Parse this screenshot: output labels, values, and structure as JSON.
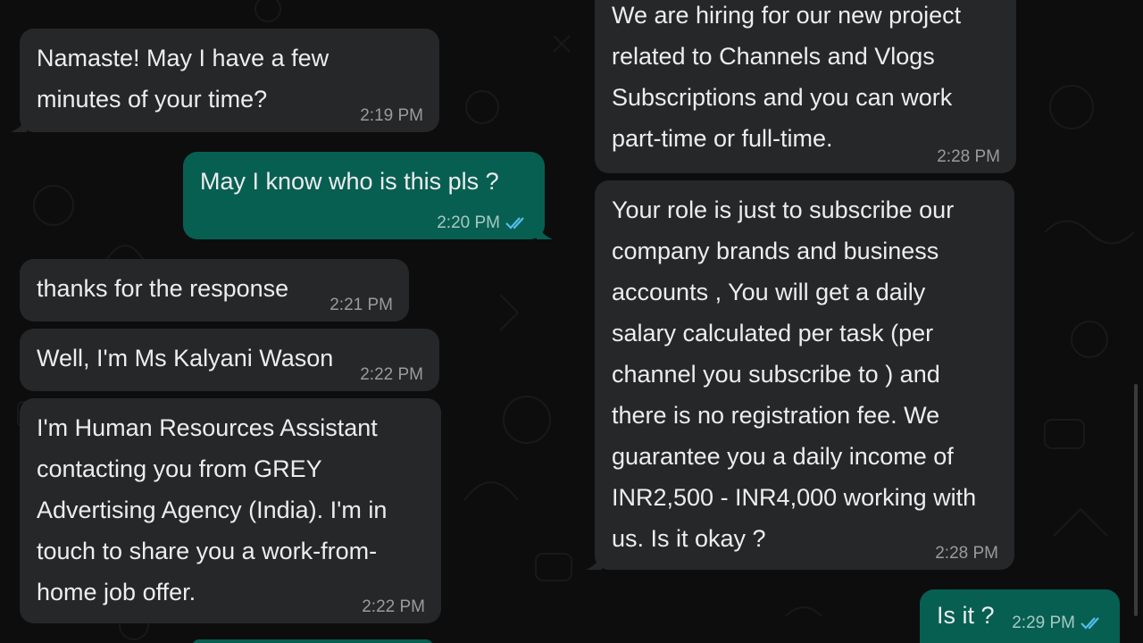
{
  "chat": {
    "left_column": [
      {
        "direction": "incoming",
        "text": "Namaste! May I have a few\nminutes of your time?",
        "time": "2:19 PM"
      },
      {
        "direction": "outgoing",
        "text": "May I know who is this pls ?",
        "time": "2:20 PM",
        "read": true
      },
      {
        "direction": "incoming",
        "text": "thanks for the response",
        "time": "2:21 PM"
      },
      {
        "direction": "incoming",
        "text": "Well, I'm Ms Kalyani Wason",
        "time": "2:22 PM"
      },
      {
        "direction": "incoming",
        "text": "I'm Human Resources Assistant\ncontacting you from GREY\nAdvertising Agency (India). I'm in\ntouch to share you a work-from-\nhome job offer.",
        "time": "2:22 PM"
      }
    ],
    "right_column": [
      {
        "direction": "incoming",
        "text": "We are hiring for our new project\nrelated to Channels and Vlogs\nSubscriptions and you can work\npart-time or full-time.",
        "time": "2:28 PM"
      },
      {
        "direction": "incoming",
        "text": "Your role is just to subscribe our\ncompany brands and business\naccounts , You will get a daily\nsalary calculated per task (per\nchannel you subscribe to ) and\nthere is no registration fee. We\nguarantee you a daily income of\nINR2,500 - INR4,000 working with\nus. Is it okay ?",
        "time": "2:28 PM"
      },
      {
        "direction": "outgoing",
        "text": "Is it ?",
        "time": "2:29 PM",
        "read": true
      }
    ]
  },
  "colors": {
    "incoming_bubble": "#262729",
    "outgoing_bubble": "#075f52",
    "read_ticks": "#53bdeb",
    "background": "#0d0d0e"
  },
  "icons": {
    "read_receipt": "double-check-icon"
  }
}
